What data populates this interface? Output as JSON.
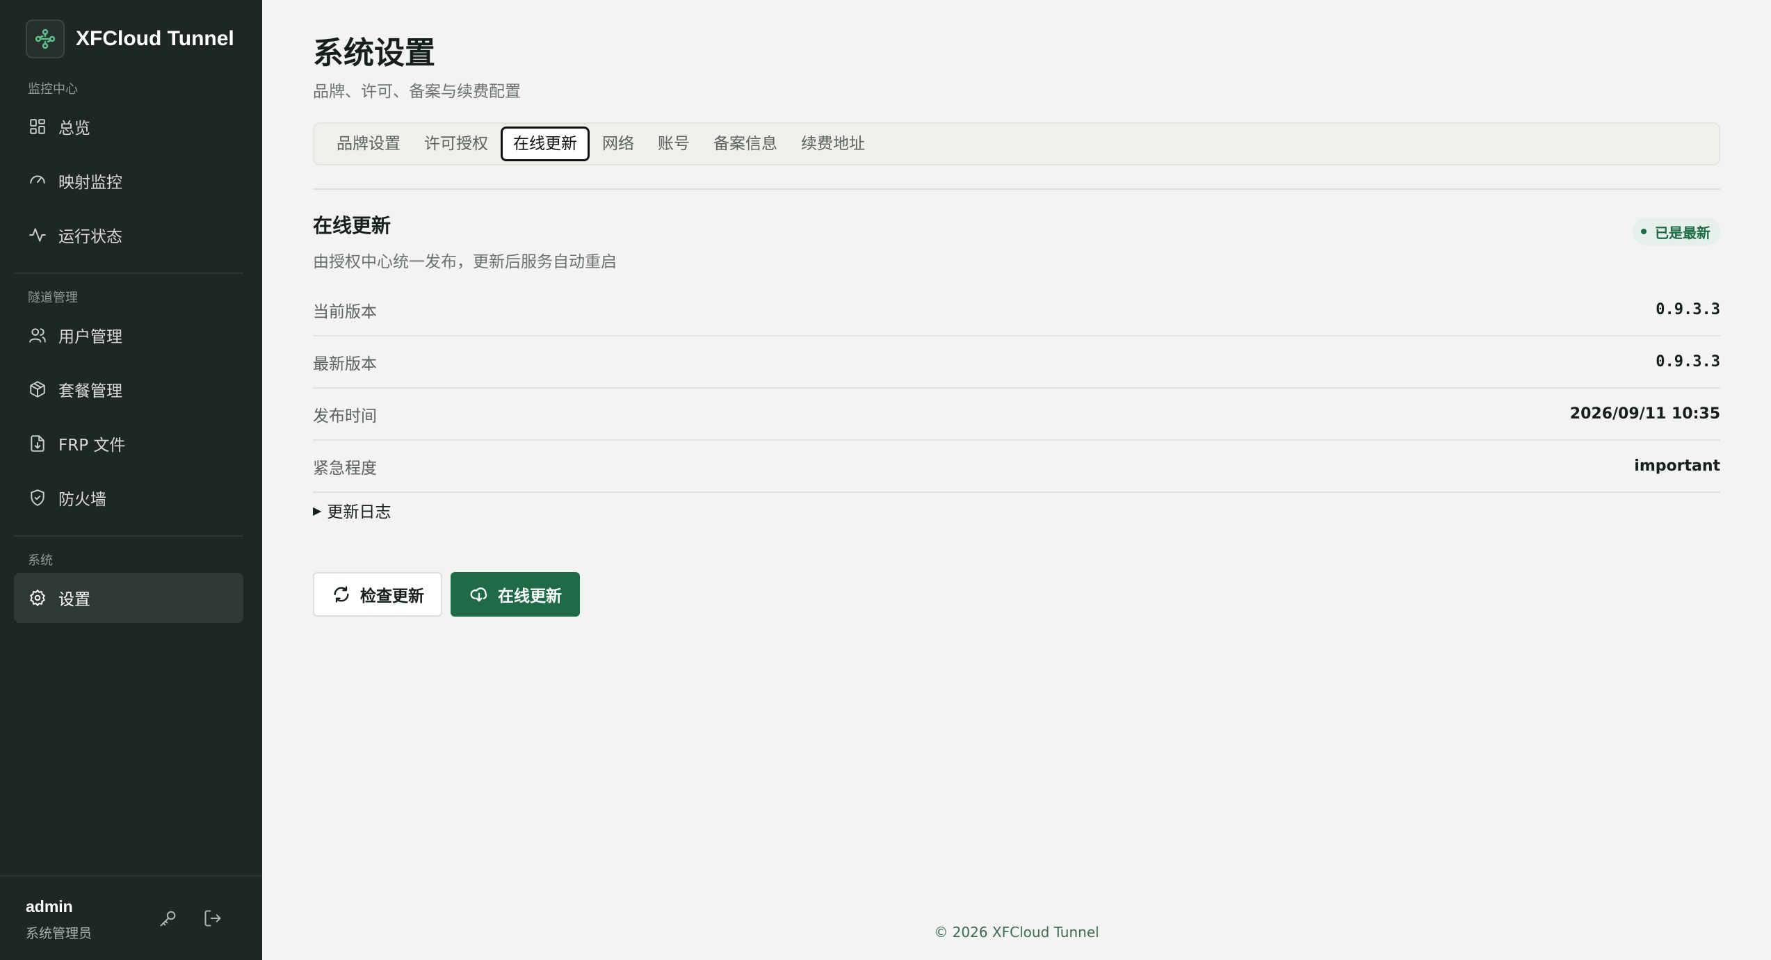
{
  "brand": {
    "name": "XFCloud Tunnel",
    "logo_icon": "network-nodes-icon"
  },
  "sidebar": {
    "sections": [
      {
        "label": "监控中心",
        "items": [
          {
            "label": "总览",
            "icon": "grid-icon"
          },
          {
            "label": "映射监控",
            "icon": "gauge-icon"
          },
          {
            "label": "运行状态",
            "icon": "activity-icon"
          }
        ]
      },
      {
        "label": "隧道管理",
        "items": [
          {
            "label": "用户管理",
            "icon": "users-icon"
          },
          {
            "label": "套餐管理",
            "icon": "package-icon"
          },
          {
            "label": "FRP 文件",
            "icon": "file-download-icon"
          },
          {
            "label": "防火墙",
            "icon": "shield-check-icon"
          }
        ]
      },
      {
        "label": "系统",
        "items": [
          {
            "label": "设置",
            "icon": "gear-icon",
            "active": true
          }
        ]
      }
    ],
    "user": {
      "name": "admin",
      "role": "系统管理员"
    }
  },
  "page": {
    "title": "系统设置",
    "subtitle": "品牌、许可、备案与续费配置",
    "tabs": [
      "品牌设置",
      "许可授权",
      "在线更新",
      "网络",
      "账号",
      "备案信息",
      "续费地址"
    ],
    "active_tab": "在线更新"
  },
  "update": {
    "title": "在线更新",
    "description": "由授权中心统一发布，更新后服务自动重启",
    "status_badge": "已是最新",
    "rows": [
      {
        "key": "当前版本",
        "value": "0.9.3.3"
      },
      {
        "key": "最新版本",
        "value": "0.9.3.3"
      },
      {
        "key": "发布时间",
        "value": "2026/09/11 10:35"
      },
      {
        "key": "紧急程度",
        "value": "important"
      }
    ],
    "changelog_label": "更新日志",
    "check_button": "检查更新",
    "update_button": "在线更新"
  },
  "footer": {
    "copyright": "© 2026 XFCloud Tunnel"
  },
  "colors": {
    "sidebar_bg": "#1e2723",
    "accent": "#1f6b47",
    "page_bg": "#f3f3f1"
  }
}
